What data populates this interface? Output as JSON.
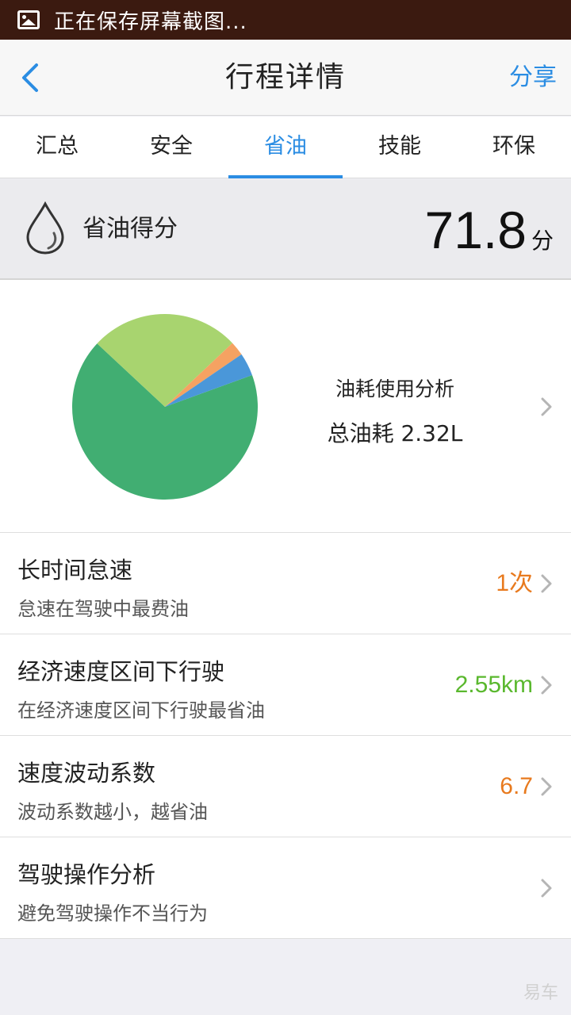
{
  "status_bar": {
    "text": "正在保存屏幕截图..."
  },
  "header": {
    "title": "行程详情",
    "share_label": "分享"
  },
  "tabs": [
    {
      "label": "汇总",
      "active": false
    },
    {
      "label": "安全",
      "active": false
    },
    {
      "label": "省油",
      "active": true
    },
    {
      "label": "技能",
      "active": false
    },
    {
      "label": "环保",
      "active": false
    }
  ],
  "score": {
    "label": "省油得分",
    "value": "71.8",
    "unit": "分"
  },
  "fuel": {
    "title": "油耗使用分析",
    "total": "总油耗 2.32L"
  },
  "chart_data": {
    "type": "pie",
    "values": [
      67.5,
      26.0,
      2.5,
      4.0
    ],
    "colors": [
      "#41ae72",
      "#a8d46f",
      "#f5a262",
      "#4a97d9"
    ]
  },
  "rows": [
    {
      "title": "长时间怠速",
      "subtitle": "怠速在驾驶中最费油",
      "value": "1次",
      "value_color": "#e87a1e"
    },
    {
      "title": "经济速度区间下行驶",
      "subtitle": "在经济速度区间下行驶最省油",
      "value": "2.55km",
      "value_color": "#5ab82e"
    },
    {
      "title": "速度波动系数",
      "subtitle": "波动系数越小，越省油",
      "value": "6.7",
      "value_color": "#e87a1e"
    },
    {
      "title": "驾驶操作分析",
      "subtitle": "避免驾驶操作不当行为",
      "value": "",
      "value_color": "#e87a1e"
    }
  ],
  "colors": {
    "accent": "#2b8de3",
    "status_bar": "#3b1a10"
  },
  "icons": {
    "status": "image-icon",
    "back": "back-chevron-icon",
    "score": "water-drop-icon",
    "row": "chevron-right-icon"
  },
  "watermark": "易车"
}
